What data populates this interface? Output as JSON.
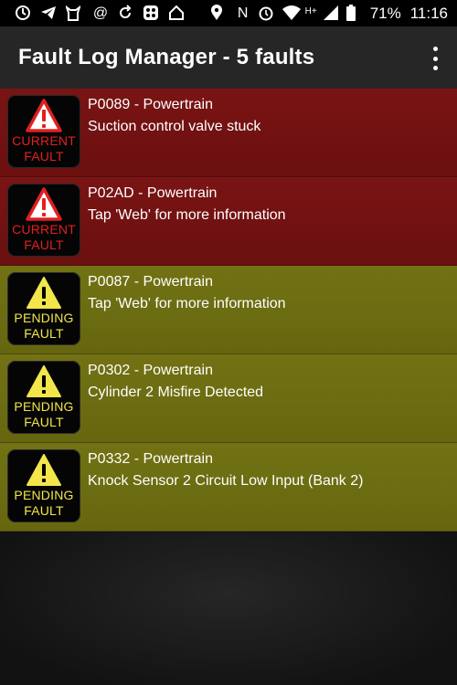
{
  "status_bar": {
    "battery": "71%",
    "time": "11:16",
    "network_type": "H+",
    "icons_left": [
      "sync-icon",
      "telegram-icon",
      "cat-icon",
      "at-icon",
      "refresh-icon",
      "grid-icon",
      "home-icon"
    ],
    "icons_right": [
      "location-icon",
      "nfc-icon",
      "alarm-icon",
      "wifi-icon",
      "signal-icon",
      "battery-icon"
    ]
  },
  "app_bar": {
    "title": "Fault Log Manager - 5 faults",
    "menu_icon": "overflow-menu-icon"
  },
  "colors": {
    "current_row": "#741212",
    "pending_row": "#6e6e12",
    "current_text": "#e02020",
    "pending_text": "#f2e64a"
  },
  "faults": [
    {
      "code_line": "P0089 - Powertrain",
      "description": "Suction control valve stuck",
      "status": "current",
      "badge_line1": "CURRENT",
      "badge_line2": "FAULT"
    },
    {
      "code_line": "P02AD - Powertrain",
      "description": "Tap 'Web' for more information",
      "status": "current",
      "badge_line1": "CURRENT",
      "badge_line2": "FAULT"
    },
    {
      "code_line": "P0087 - Powertrain",
      "description": "Tap 'Web' for more information",
      "status": "pending",
      "badge_line1": "PENDING",
      "badge_line2": "FAULT"
    },
    {
      "code_line": "P0302 - Powertrain",
      "description": "Cylinder 2 Misfire Detected",
      "status": "pending",
      "badge_line1": "PENDING",
      "badge_line2": "FAULT"
    },
    {
      "code_line": "P0332 - Powertrain",
      "description": "Knock Sensor 2 Circuit Low Input (Bank 2)",
      "status": "pending",
      "badge_line1": "PENDING",
      "badge_line2": "FAULT"
    }
  ]
}
